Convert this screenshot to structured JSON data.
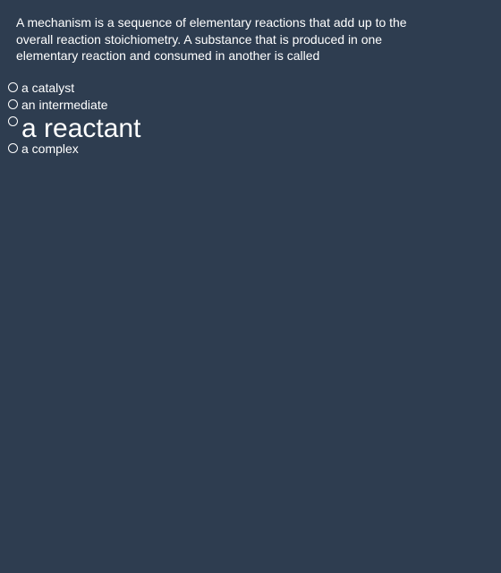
{
  "question": {
    "text": "A mechanism is a sequence of elementary reactions that add up to the overall reaction stoichiometry. A substance that is produced in one elementary reaction and consumed in another is called"
  },
  "options": [
    {
      "label": "a catalyst"
    },
    {
      "label": "an intermediate"
    },
    {
      "label": "a reactant"
    },
    {
      "label": "a complex"
    }
  ],
  "colors": {
    "background": "#2e3d50",
    "text": "#ffffff"
  }
}
